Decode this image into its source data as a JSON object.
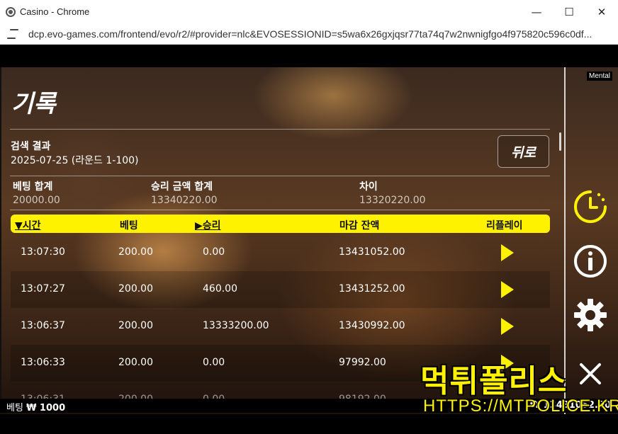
{
  "window": {
    "title": "Casino - Chrome",
    "controls": {
      "minimize": "—",
      "maximize": "☐",
      "close": "✕"
    }
  },
  "address_bar": {
    "url": "dcp.evo-games.com/frontend/evo/r2/#provider=nlc&EVOSESSIONID=s5wa6x26gxjqsr77ta74q7w2nwnigfgo4f975820c596c0df..."
  },
  "history": {
    "title": "기록",
    "search_label": "검색 결과",
    "search_range": "2025-07-25 (라운드 1-100)",
    "back_label": "뒤로",
    "summary": [
      {
        "label": "베팅 합계",
        "value": "20000.00"
      },
      {
        "label": "승리 금액 합계",
        "value": "13340220.00"
      },
      {
        "label": "차이",
        "value": "13320220.00"
      }
    ],
    "columns": {
      "time": "시간",
      "bet": "베팅",
      "win": "승리",
      "balance": "마감 잔액",
      "replay": "리플레이"
    },
    "rows": [
      {
        "time": "13:07:30",
        "bet": "200.00",
        "win": "0.00",
        "balance": "13431052.00"
      },
      {
        "time": "13:07:27",
        "bet": "200.00",
        "win": "460.00",
        "balance": "13431252.00"
      },
      {
        "time": "13:06:37",
        "bet": "200.00",
        "win": "13333200.00",
        "balance": "13430992.00"
      },
      {
        "time": "13:06:33",
        "bet": "200.00",
        "win": "0.00",
        "balance": "97992.00"
      },
      {
        "time": "13:06:31",
        "bet": "200.00",
        "win": "0.00",
        "balance": "98192.00"
      }
    ]
  },
  "sidebar": {
    "badge": "Mental",
    "icons": [
      "clock-icon",
      "info-icon",
      "gear-icon",
      "close-icon"
    ],
    "accent_color": "#fff200"
  },
  "footer": {
    "bet_label": "베팅",
    "bet_value": "₩ 1000",
    "balance_value": "₩ 13431052.00"
  },
  "watermark": {
    "main": "먹튀폴리스",
    "url": "HTTPS://MTPOLICE.KR"
  }
}
